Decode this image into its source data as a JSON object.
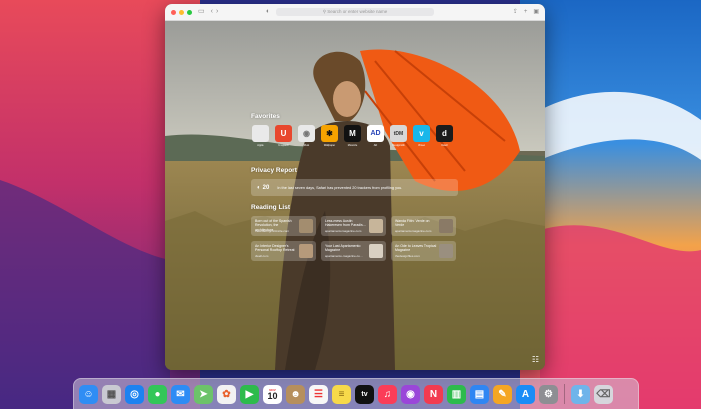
{
  "browser": {
    "address_placeholder": "Search or enter website name",
    "traffic_lights": [
      "#ff5f57",
      "#febc2e",
      "#28c840"
    ]
  },
  "favorites": {
    "title": "Favorites",
    "items": [
      {
        "label": "Apple",
        "glyph": "",
        "bg": "#e9e9e9",
        "fg": "#111"
      },
      {
        "label": "Unsplash",
        "glyph": "U",
        "bg": "#e8472d",
        "fg": "#fff"
      },
      {
        "label": "Musi",
        "glyph": "◉",
        "bg": "#e9e9e9",
        "fg": "#777"
      },
      {
        "label": "Wallpaper",
        "glyph": "✱",
        "bg": "#f6a300",
        "fg": "#111"
      },
      {
        "label": "Monocle",
        "glyph": "M",
        "bg": "#111111",
        "fg": "#fff"
      },
      {
        "label": "AD",
        "glyph": "AD",
        "bg": "#ffffff",
        "fg": "#2946b9"
      },
      {
        "label": "Designmilk",
        "glyph": "tDM",
        "bg": "#d7d7d7",
        "fg": "#333"
      },
      {
        "label": "Vimeo",
        "glyph": "v",
        "bg": "#19b7ea",
        "fg": "#fff"
      },
      {
        "label": "Dwell",
        "glyph": "d",
        "bg": "#1c1c1c",
        "fg": "#fff"
      }
    ]
  },
  "privacy": {
    "title": "Privacy Report",
    "count": "20",
    "text": "In the last seven days, Safari has prevented 20 trackers from profiling you."
  },
  "reading_list": {
    "title": "Reading List",
    "items": [
      {
        "title": "Born out of the Spanish Revolution, the architecture…",
        "domain": "theamazingchronicle.com",
        "thumb": "#a38d6f"
      },
      {
        "title": "Less-mess Austin Hakeresen from Paradis…",
        "domain": "apartamentomagazine.com",
        "thumb": "#c7b59a"
      },
      {
        "title": "Wanda Fitin: Verde on Verde",
        "domain": "apartamentomagazine.com",
        "thumb": "#8a7a66"
      },
      {
        "title": "An Interior Designer's Personal Rooftop Retreat",
        "domain": "dwell.com",
        "thumb": "#b69a7b"
      },
      {
        "title": "Your Last Apartamento Magazine",
        "domain": "apartamento-magazine.co…",
        "thumb": "#d9d0c2"
      },
      {
        "title": "An Ode to Leaves Tropical Magazine",
        "domain": "thedesignfiles.com",
        "thumb": "#9a8f7f"
      }
    ]
  },
  "dock": {
    "items": [
      {
        "name": "finder-icon",
        "glyph": "☺",
        "bg": "#2f8df4"
      },
      {
        "name": "launchpad-icon",
        "glyph": "▦",
        "bg": "#c9c9d2"
      },
      {
        "name": "safari-icon",
        "glyph": "◎",
        "bg": "#1d82f0"
      },
      {
        "name": "messages-icon",
        "glyph": "●",
        "bg": "#32c759"
      },
      {
        "name": "mail-icon",
        "glyph": "✉",
        "bg": "#2d8cf5"
      },
      {
        "name": "maps-icon",
        "glyph": "➤",
        "bg": "#6cc36a"
      },
      {
        "name": "photos-icon",
        "glyph": "✿",
        "bg": "#f2f2f2"
      },
      {
        "name": "facetime-icon",
        "glyph": "▶",
        "bg": "#2dbb4c"
      },
      {
        "name": "calendar-icon",
        "glyph": "",
        "bg": "#ffffff"
      },
      {
        "name": "contacts-icon",
        "glyph": "☻",
        "bg": "#b68f5d"
      },
      {
        "name": "reminders-icon",
        "glyph": "☰",
        "bg": "#f7f7f7"
      },
      {
        "name": "notes-icon",
        "glyph": "≡",
        "bg": "#f7d94a"
      },
      {
        "name": "tv-icon",
        "glyph": "tv",
        "bg": "#111111"
      },
      {
        "name": "music-icon",
        "glyph": "♫",
        "bg": "#fb3d58"
      },
      {
        "name": "podcasts-icon",
        "glyph": "◉",
        "bg": "#9a46d9"
      },
      {
        "name": "news-icon",
        "glyph": "N",
        "bg": "#f23b50"
      },
      {
        "name": "numbers-icon",
        "glyph": "▥",
        "bg": "#2dbb4c"
      },
      {
        "name": "keynote-icon",
        "glyph": "▤",
        "bg": "#2f86f3"
      },
      {
        "name": "pages-icon",
        "glyph": "✎",
        "bg": "#f5a623"
      },
      {
        "name": "app-store-icon",
        "glyph": "A",
        "bg": "#1b8cf6"
      },
      {
        "name": "system-preferences-icon",
        "glyph": "⚙",
        "bg": "#8e8e93"
      }
    ],
    "calendar": {
      "month": "NOV",
      "day": "10"
    },
    "trailing": [
      {
        "name": "downloads-folder-icon",
        "glyph": "⬇",
        "bg": "#6fb4ea"
      },
      {
        "name": "trash-icon",
        "glyph": "🗑",
        "bg": "#d6d6dc"
      }
    ]
  }
}
